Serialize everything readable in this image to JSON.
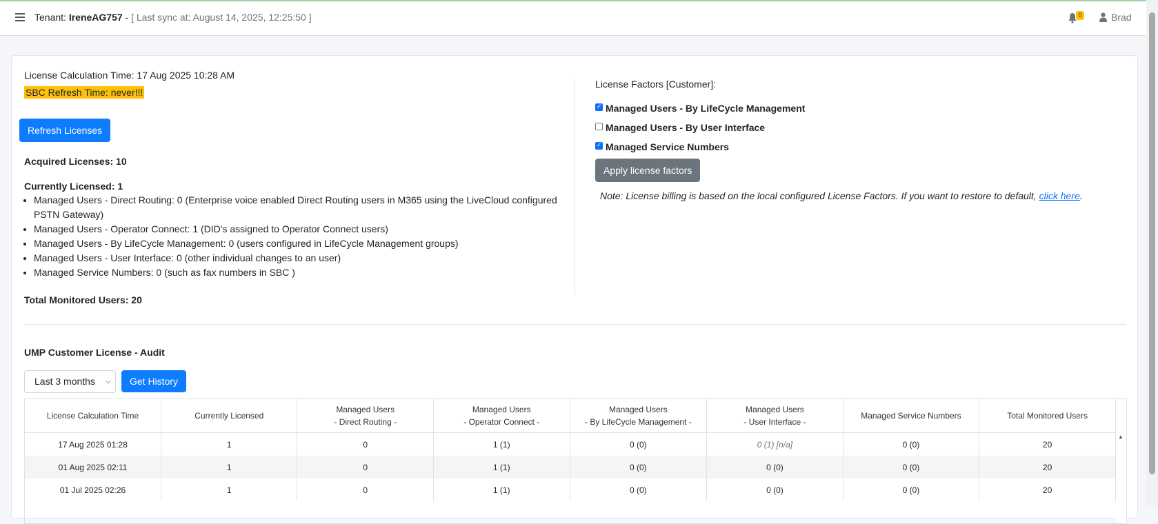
{
  "header": {
    "tenant_label": "Tenant:",
    "tenant_name": "IreneAG757",
    "separator": " - ",
    "sync_text": "[ Last sync at: August 14, 2025, 12:25:50 ]",
    "notification_count": "0",
    "user_name": "Brad"
  },
  "left": {
    "calc_time": "License Calculation Time: 17 Aug 2025 10:28 AM",
    "sbc_refresh": "SBC Refresh Time: never!!!",
    "refresh_button": "Refresh Licenses",
    "acquired": "Acquired Licenses: 10",
    "currently": "Currently Licensed: 1",
    "items": [
      "Managed Users - Direct Routing: 0 (Enterprise voice enabled Direct Routing users in M365 using the LiveCloud configured PSTN Gateway)",
      "Managed Users - Operator Connect: 1 (DID's assigned to Operator Connect users)",
      "Managed Users - By LifeCycle Management: 0 (users configured in LifeCycle Management groups)",
      "Managed Users - User Interface: 0 (other individual changes to an user)",
      "Managed Service Numbers: 0 (such as fax numbers in SBC )"
    ],
    "total": "Total Monitored Users: 20"
  },
  "right": {
    "title": "License Factors [Customer]:",
    "factors": [
      {
        "label": "Managed Users - By LifeCycle Management",
        "checked": true
      },
      {
        "label": "Managed Users - By User Interface",
        "checked": false
      },
      {
        "label": "Managed Service Numbers",
        "checked": true
      }
    ],
    "apply_button": "Apply license factors",
    "note_text": "Note: License billing is based on the local configured License Factors. If you want to restore to default, ",
    "note_link": "click here",
    "note_end": "."
  },
  "audit": {
    "title": "UMP Customer License - Audit",
    "range_value": "Last 3 months",
    "history_button": "Get History",
    "columns": [
      [
        "License Calculation Time"
      ],
      [
        "Currently Licensed"
      ],
      [
        "Managed Users",
        "- Direct Routing -"
      ],
      [
        "Managed Users",
        "- Operator Connect -"
      ],
      [
        "Managed Users",
        "- By LifeCycle Management -"
      ],
      [
        "Managed Users",
        "- User Interface -"
      ],
      [
        "Managed Service Numbers"
      ],
      [
        "Total Monitored Users"
      ]
    ],
    "rows": [
      [
        "17 Aug 2025 01:28",
        "1",
        "0",
        "1 (1)",
        "0 (0)",
        "0 (1) [n/a]",
        "0 (0)",
        "20"
      ],
      [
        "01 Aug 2025 02:11",
        "1",
        "0",
        "1 (1)",
        "0 (0)",
        "0 (0)",
        "0 (0)",
        "20"
      ],
      [
        "01 Jul 2025 02:26",
        "1",
        "0",
        "1 (1)",
        "0 (0)",
        "0 (0)",
        "0 (0)",
        "20"
      ]
    ]
  }
}
